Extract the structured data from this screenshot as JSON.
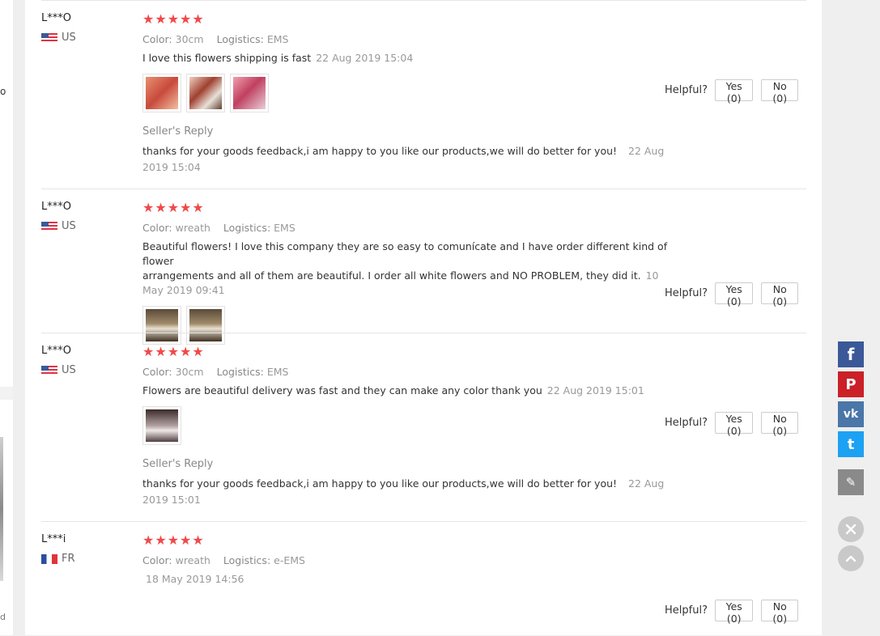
{
  "left_fragments": [
    "o",
    "d"
  ],
  "reviews": [
    {
      "user": "L***O",
      "country": "US",
      "stars": "★★★★★",
      "color_label": "Color:",
      "color": "30cm",
      "logistics_label": "Logistics:",
      "logistics": "EMS",
      "text": "I love this flowers shipping is fast",
      "date": "22 Aug 2019 15:04",
      "seller_reply_label": "Seller's Reply",
      "reply_text": "thanks for your goods feedback,i am happy to you like our products,we will do better for you!",
      "reply_date": "22 Aug 2019 15:04"
    },
    {
      "user": "L***O",
      "country": "US",
      "stars": "★★★★★",
      "color_label": "Color:",
      "color": "wreath",
      "logistics_label": "Logistics:",
      "logistics": "EMS",
      "text_line1": "Beautiful flowers! I love this company they are so easy to comunícate and I have order different kind of flower",
      "text_line2": "arrangements and all of them are beautiful. I order all white flowers and NO PROBLEM, they did it.",
      "date": "10 May 2019 09:41"
    },
    {
      "user": "L***O",
      "country": "US",
      "stars": "★★★★★",
      "color_label": "Color:",
      "color": "30cm",
      "logistics_label": "Logistics:",
      "logistics": "EMS",
      "text": "Flowers are beautiful delivery was fast and they can make any color thank you",
      "date": "22 Aug 2019 15:01",
      "seller_reply_label": "Seller's Reply",
      "reply_text": "thanks for your goods feedback,i am happy to you like our products,we will do better for you!",
      "reply_date": "22 Aug 2019 15:01"
    },
    {
      "user": "L***i",
      "country": "FR",
      "stars": "★★★★★",
      "color_label": "Color:",
      "color": "wreath",
      "logistics_label": "Logistics:",
      "logistics": "e-EMS",
      "date": "18 May 2019 14:56"
    }
  ],
  "helpful": {
    "label": "Helpful?",
    "yes": "Yes (0)",
    "no": "No (0)"
  },
  "share_bar": [
    {
      "name": "facebook-icon",
      "glyph": "f",
      "color": "#3b5998"
    },
    {
      "name": "pinterest-icon",
      "glyph": "P",
      "color": "#cb2027"
    },
    {
      "name": "vk-icon",
      "glyph": "vk",
      "color": "#4a76a8"
    },
    {
      "name": "twitter-icon",
      "glyph": "t",
      "color": "#1da1f2"
    },
    {
      "name": "edit-icon",
      "glyph": "✎",
      "color": "#8a8a8a"
    }
  ],
  "colors": {
    "star": "#f0494a",
    "panel": "#ffffff",
    "background": "#efefef"
  }
}
